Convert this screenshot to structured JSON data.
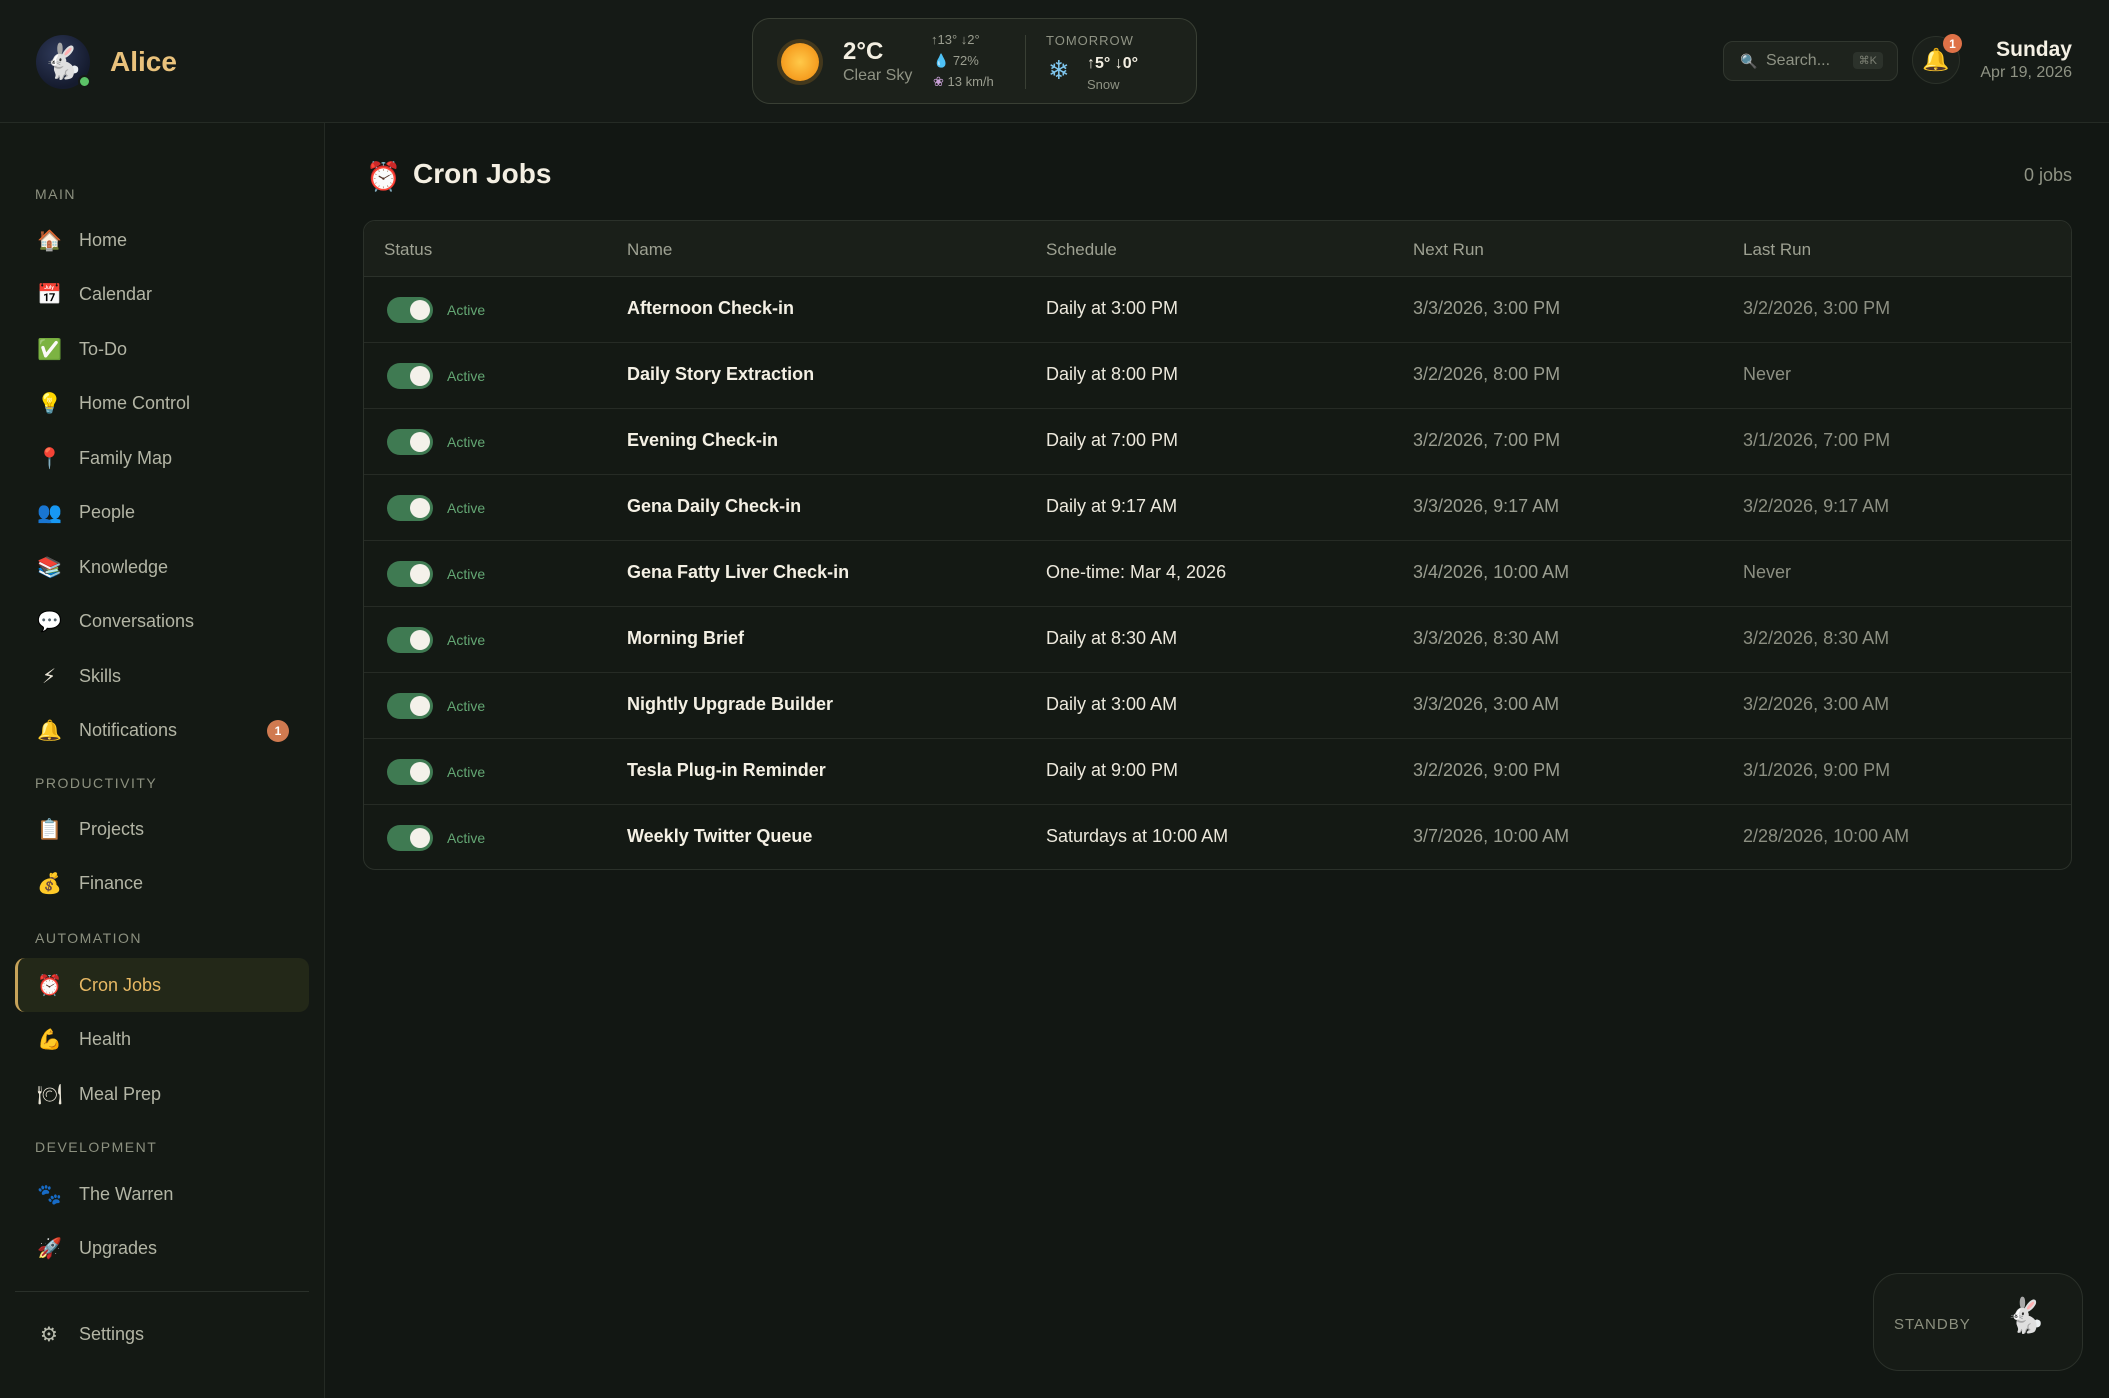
{
  "app": {
    "name": "Alice",
    "logo_icon": "rabbit-icon",
    "online_color": "#5cc267",
    "accent": "#e9c27c"
  },
  "weather": {
    "temp": "2°C",
    "condition": "Clear Sky",
    "hi_lo": "↑13° ↓2°",
    "humidity": "72%",
    "wind": "13 km/h",
    "tomorrow_label": "TOMORROW",
    "tomorrow_temp": "↑5° ↓0°",
    "tomorrow_condition": "Snow"
  },
  "search": {
    "placeholder": "Search...",
    "shortcut": "⌘K"
  },
  "notifications": {
    "count": "1"
  },
  "date": {
    "day": "Sunday",
    "full": "Apr 19, 2026"
  },
  "sidebar": {
    "sections": [
      {
        "label": "MAIN"
      },
      {
        "label": "PRODUCTIVITY"
      },
      {
        "label": "AUTOMATION"
      },
      {
        "label": "DEVELOPMENT"
      }
    ],
    "items": [
      {
        "label": "Home",
        "icon": "house-icon"
      },
      {
        "label": "Calendar",
        "icon": "calendar-icon"
      },
      {
        "label": "To-Do",
        "icon": "checkbox-icon"
      },
      {
        "label": "Home Control",
        "icon": "lightbulb-icon"
      },
      {
        "label": "Family Map",
        "icon": "pin-icon"
      },
      {
        "label": "People",
        "icon": "people-icon"
      },
      {
        "label": "Knowledge",
        "icon": "books-icon"
      },
      {
        "label": "Conversations",
        "icon": "speech-bubble-icon"
      },
      {
        "label": "Skills",
        "icon": "lightning-icon"
      },
      {
        "label": "Notifications",
        "icon": "bell-icon",
        "badge": "1"
      },
      {
        "label": "Projects",
        "icon": "clipboard-icon"
      },
      {
        "label": "Finance",
        "icon": "money-bag-icon"
      },
      {
        "label": "Cron Jobs",
        "icon": "alarm-clock-icon",
        "active": true
      },
      {
        "label": "Health",
        "icon": "flexed-arm-icon"
      },
      {
        "label": "Meal Prep",
        "icon": "plate-icon"
      },
      {
        "label": "The Warren",
        "icon": "paw-icon"
      },
      {
        "label": "Upgrades",
        "icon": "rocket-icon"
      },
      {
        "label": "Settings",
        "icon": "gear-icon"
      }
    ]
  },
  "page": {
    "title": "Cron Jobs",
    "count": "0 jobs",
    "icon": "alarm-clock-icon"
  },
  "table": {
    "headers": [
      "Status",
      "Name",
      "Schedule",
      "Next Run",
      "Last Run"
    ],
    "rows": [
      {
        "status": "Active",
        "enabled": true,
        "name": "Afternoon Check-in",
        "schedule": "Daily at 3:00 PM",
        "next": "3/3/2026, 3:00 PM",
        "last": "3/2/2026, 3:00 PM"
      },
      {
        "status": "Active",
        "enabled": true,
        "name": "Daily Story Extraction",
        "schedule": "Daily at 8:00 PM",
        "next": "3/2/2026, 8:00 PM",
        "last": "Never"
      },
      {
        "status": "Active",
        "enabled": true,
        "name": "Evening Check-in",
        "schedule": "Daily at 7:00 PM",
        "next": "3/2/2026, 7:00 PM",
        "last": "3/1/2026, 7:00 PM"
      },
      {
        "status": "Active",
        "enabled": true,
        "name": "Gena Daily Check-in",
        "schedule": "Daily at 9:17 AM",
        "next": "3/3/2026, 9:17 AM",
        "last": "3/2/2026, 9:17 AM"
      },
      {
        "status": "Active",
        "enabled": true,
        "name": "Gena Fatty Liver Check-in",
        "schedule": "One-time: Mar 4, 2026",
        "next": "3/4/2026, 10:00 AM",
        "last": "Never"
      },
      {
        "status": "Active",
        "enabled": true,
        "name": "Morning Brief",
        "schedule": "Daily at 8:30 AM",
        "next": "3/3/2026, 8:30 AM",
        "last": "3/2/2026, 8:30 AM"
      },
      {
        "status": "Active",
        "enabled": true,
        "name": "Nightly Upgrade Builder",
        "schedule": "Daily at 3:00 AM",
        "next": "3/3/2026, 3:00 AM",
        "last": "3/2/2026, 3:00 AM"
      },
      {
        "status": "Active",
        "enabled": true,
        "name": "Tesla Plug-in Reminder",
        "schedule": "Daily at 9:00 PM",
        "next": "3/2/2026, 9:00 PM",
        "last": "3/1/2026, 9:00 PM"
      },
      {
        "status": "Active",
        "enabled": true,
        "name": "Weekly Twitter Queue",
        "schedule": "Saturdays at 10:00 AM",
        "next": "3/7/2026, 10:00 AM",
        "last": "2/28/2026, 10:00 AM"
      }
    ]
  },
  "standby": {
    "label": "STANDBY",
    "icon": "rabbit-icon"
  },
  "colors": {
    "active_green": "#3f7a52",
    "status_text": "#63a673",
    "badge": "#df7248"
  }
}
